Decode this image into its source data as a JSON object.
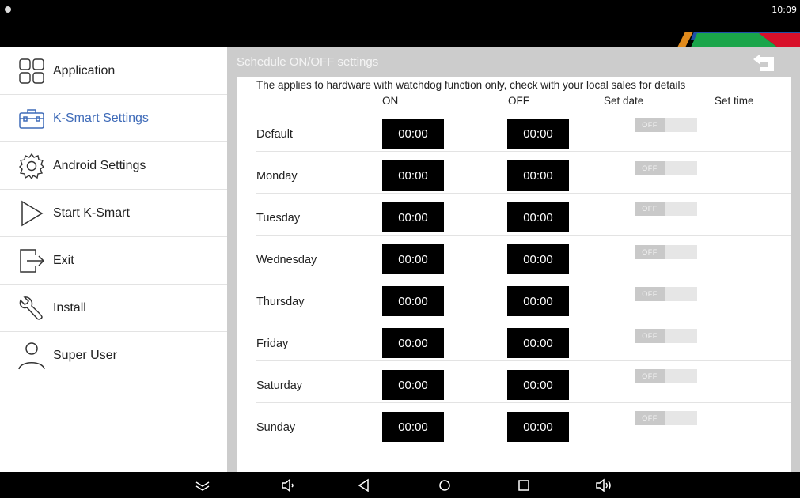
{
  "status_bar": {
    "time": "10:09"
  },
  "sidebar": {
    "items": [
      {
        "label": "Application",
        "icon": "grid-icon",
        "active": false
      },
      {
        "label": "K-Smart Settings",
        "icon": "toolbox-icon",
        "active": true
      },
      {
        "label": "Android Settings",
        "icon": "gear-icon",
        "active": false
      },
      {
        "label": "Start K-Smart",
        "icon": "play-icon",
        "active": false
      },
      {
        "label": "Exit",
        "icon": "exit-icon",
        "active": false
      },
      {
        "label": "Install",
        "icon": "wrench-icon",
        "active": false
      },
      {
        "label": "Super User",
        "icon": "user-icon",
        "active": false
      }
    ]
  },
  "main": {
    "title": "Schedule ON/OFF settings",
    "notice": "The applies to hardware with watchdog function only, check with your local sales for details",
    "columns": {
      "on": "ON",
      "off": "OFF",
      "set_date": "Set date",
      "set_time": "Set time"
    },
    "rows": [
      {
        "day": "Default",
        "on": "00:00",
        "off": "00:00",
        "toggle": "OFF"
      },
      {
        "day": "Monday",
        "on": "00:00",
        "off": "00:00",
        "toggle": "OFF"
      },
      {
        "day": "Tuesday",
        "on": "00:00",
        "off": "00:00",
        "toggle": "OFF"
      },
      {
        "day": "Wednesday",
        "on": "00:00",
        "off": "00:00",
        "toggle": "OFF"
      },
      {
        "day": "Thursday",
        "on": "00:00",
        "off": "00:00",
        "toggle": "OFF"
      },
      {
        "day": "Friday",
        "on": "00:00",
        "off": "00:00",
        "toggle": "OFF"
      },
      {
        "day": "Saturday",
        "on": "00:00",
        "off": "00:00",
        "toggle": "OFF"
      },
      {
        "day": "Sunday",
        "on": "00:00",
        "off": "00:00",
        "toggle": "OFF"
      }
    ]
  },
  "colors": {
    "accent": "#3f6bb8",
    "panel": "#cccccc",
    "time_box": "#000000",
    "stripe_orange": "#e08a1c",
    "stripe_blue": "#1f4fa8",
    "stripe_green": "#1aa54a",
    "stripe_red": "#d8102a"
  },
  "navbar": {
    "icons": [
      "collapse-icon",
      "volume-down-icon",
      "back-icon",
      "home-icon",
      "recents-icon",
      "volume-up-icon"
    ]
  }
}
